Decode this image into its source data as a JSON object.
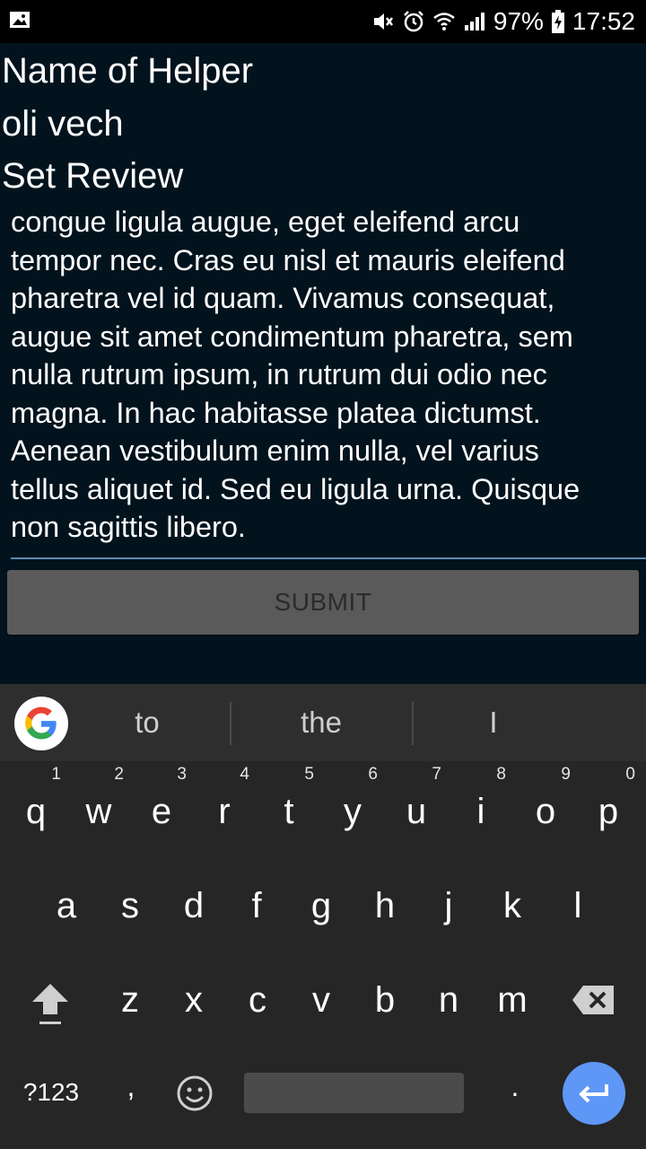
{
  "status_bar": {
    "battery": "97%",
    "time": "17:52"
  },
  "form": {
    "helper_label": "Name of Helper",
    "helper_value": "oli vech",
    "review_label": "Set Review",
    "review_text": "congue ligula augue, eget eleifend arcu\ntempor nec. Cras eu nisl et mauris eleifend\npharetra vel id quam. Vivamus consequat,\naugue sit amet condimentum pharetra, sem\nnulla rutrum ipsum, in rutrum dui odio nec\nmagna. In hac habitasse platea dictumst.\nAenean vestibulum enim nulla, vel varius\ntellus aliquet id. Sed eu ligula urna. Quisque\nnon sagittis libero.",
    "submit_label": "SUBMIT"
  },
  "keyboard": {
    "suggestions": [
      "to",
      "the",
      "I"
    ],
    "row1": [
      {
        "key": "q",
        "hint": "1"
      },
      {
        "key": "w",
        "hint": "2"
      },
      {
        "key": "e",
        "hint": "3"
      },
      {
        "key": "r",
        "hint": "4"
      },
      {
        "key": "t",
        "hint": "5"
      },
      {
        "key": "y",
        "hint": "6"
      },
      {
        "key": "u",
        "hint": "7"
      },
      {
        "key": "i",
        "hint": "8"
      },
      {
        "key": "o",
        "hint": "9"
      },
      {
        "key": "p",
        "hint": "0"
      }
    ],
    "row2": [
      "a",
      "s",
      "d",
      "f",
      "g",
      "h",
      "j",
      "k",
      "l"
    ],
    "row3": [
      "z",
      "x",
      "c",
      "v",
      "b",
      "n",
      "m"
    ],
    "symbols_label": "?123",
    "comma": ",",
    "period": "."
  },
  "icons": {
    "status_left": "image-icon",
    "status_right": [
      "mute-icon",
      "alarm-icon",
      "wifi-icon",
      "signal-icon",
      "battery-charging-icon"
    ],
    "keyboard": [
      "google-g-icon",
      "shift-icon",
      "backspace-icon",
      "emoji-icon",
      "enter-icon"
    ]
  },
  "colors": {
    "background": "#03131d",
    "field_underline": "#5c8bb5",
    "submit_bg": "#5a5a5a",
    "keyboard_bg": "#262626",
    "enter_key": "#5e97f6"
  }
}
